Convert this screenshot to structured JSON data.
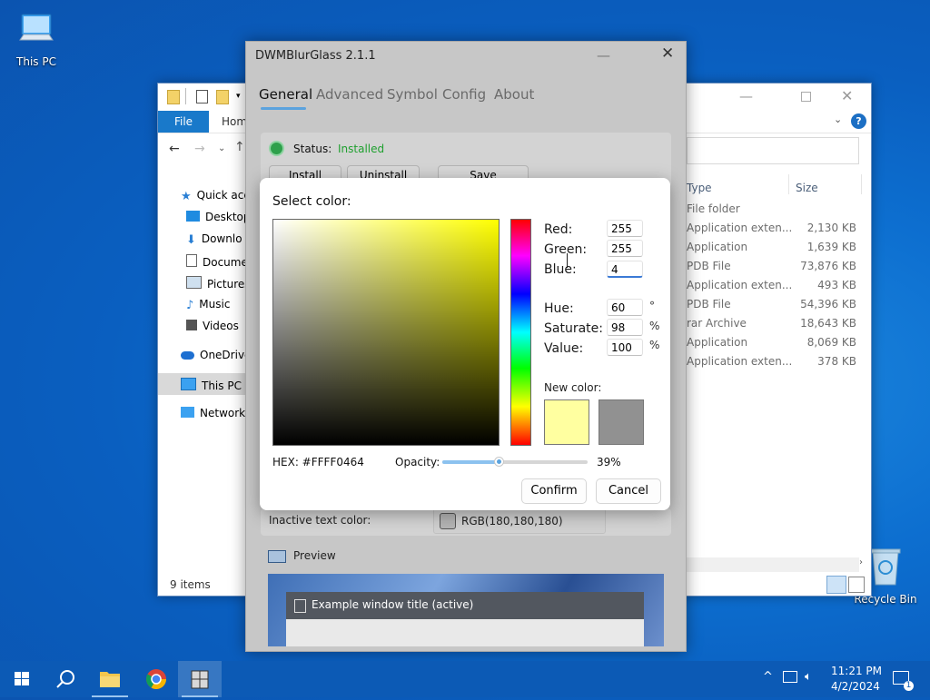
{
  "desktop": {
    "this_pc_label": "This PC",
    "recycle_bin_label": "Recycle Bin"
  },
  "explorer": {
    "ribbon": {
      "file_tab": "File",
      "home_tab": "Home"
    },
    "nav": [
      "Quick acc",
      "Desktop",
      "Downlo",
      "Docume",
      "Pictures",
      "Music",
      "Videos",
      "OneDrive",
      "This PC",
      "Network"
    ],
    "columns": {
      "type": "Type",
      "size": "Size"
    },
    "rows": [
      {
        "type": "File folder",
        "size": ""
      },
      {
        "type": "Application exten...",
        "size": "2,130 KB"
      },
      {
        "type": "Application",
        "size": "1,639 KB"
      },
      {
        "type": "PDB File",
        "size": "73,876 KB"
      },
      {
        "type": "Application exten...",
        "size": "493 KB"
      },
      {
        "type": "PDB File",
        "size": "54,396 KB"
      },
      {
        "type": "rar Archive",
        "size": "18,643 KB"
      },
      {
        "type": "Application",
        "size": "8,069 KB"
      },
      {
        "type": "Application exten...",
        "size": "378 KB"
      }
    ],
    "status": "9 items"
  },
  "app": {
    "title": "DWMBlurGlass 2.1.1",
    "tabs": [
      "General",
      "Advanced",
      "Symbol",
      "Config",
      "About"
    ],
    "active_tab": "General",
    "status_label": "Status:",
    "status_value": "Installed",
    "buttons": {
      "install": "Install",
      "uninstall": "Uninstall",
      "save": "Save"
    },
    "inactive_text_color_label": "Inactive text color:",
    "inactive_text_color_value": "RGB(180,180,180)",
    "preview_label": "Preview",
    "example_window_title": "Example window title (active)"
  },
  "color_dialog": {
    "title": "Select color:",
    "red_label": "Red:",
    "red_value": "255",
    "green_label": "Green:",
    "green_value": "255",
    "blue_label": "Blue:",
    "blue_value": "4",
    "hue_label": "Hue:",
    "hue_value": "60",
    "hue_unit": "°",
    "saturate_label": "Saturate:",
    "saturate_value": "98",
    "saturate_unit": "%",
    "value_label": "Value:",
    "value_value": "100",
    "value_unit": "%",
    "new_color_label": "New color:",
    "new_color": "#ffffa0",
    "old_color": "#919191",
    "hex_label": "HEX: #FFFF0464",
    "opacity_label": "Opacity:",
    "opacity_value": "39%",
    "opacity_fraction": 0.39,
    "confirm": "Confirm",
    "cancel": "Cancel"
  },
  "taskbar": {
    "time": "11:21 PM",
    "date": "4/2/2024",
    "notification_count": "1"
  },
  "colors": {
    "status_green": "#1fa02f",
    "accent_blue": "#1979ca",
    "tab_underline": "#5ba3de"
  }
}
